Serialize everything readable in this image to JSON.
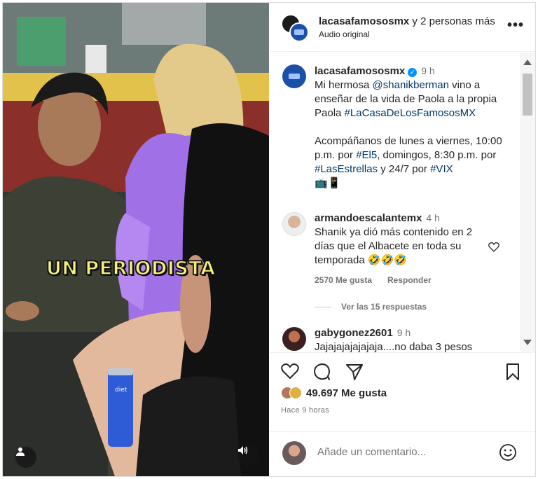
{
  "overlay_caption": "UN PERIODISTA",
  "header": {
    "account": "lacasafamososmx",
    "others": " y 2 personas más",
    "subtitle": "Audio original",
    "more_icon": "more-horizontal-icon"
  },
  "post": {
    "username": "lacasafamososmx",
    "time": "9 h",
    "line1_a": "Mi hermosa ",
    "mention": "@shanikberman",
    "line1_b": " vino a enseñar de la vida de Paola a la propia Paola ",
    "hashtag1": "#LaCasaDeLosFamososMX",
    "line2_a": "Acompáñanos de lunes a viernes, 10:00 p.m. por ",
    "hashtag2": "#El5",
    "line2_b": ", domingos, 8:30 p.m. por ",
    "hashtag3": "#LasEstrellas",
    "line2_c": " y 24/7 por ",
    "hashtag4": "#VIX",
    "emojis": "📺📱"
  },
  "comments": [
    {
      "username": "armandoescalantemx",
      "time": "4 h",
      "text": "Shanik ya dió más contenido en 2 días que el Albacete en toda su temporada 🤣🤣🤣",
      "likes": "2570 Me gusta",
      "reply": "Responder",
      "view_replies": "Ver las 15 respuestas"
    },
    {
      "username": "gabygonez2601",
      "time": "9 h",
      "text": "Jajajajajajajaja....no daba 3 pesos"
    }
  ],
  "actions": {
    "like_icon": "heart-icon",
    "comment_icon": "comment-icon",
    "share_icon": "send-icon",
    "save_icon": "bookmark-icon"
  },
  "likes_text": "49.697 Me gusta",
  "post_time": "Hace 9 horas",
  "add_comment_placeholder": "Añade un comentario...",
  "colors": {
    "link": "#00376b",
    "verified": "#0095f6",
    "muted": "#737373",
    "caption_yellow": "#f4f07a"
  }
}
